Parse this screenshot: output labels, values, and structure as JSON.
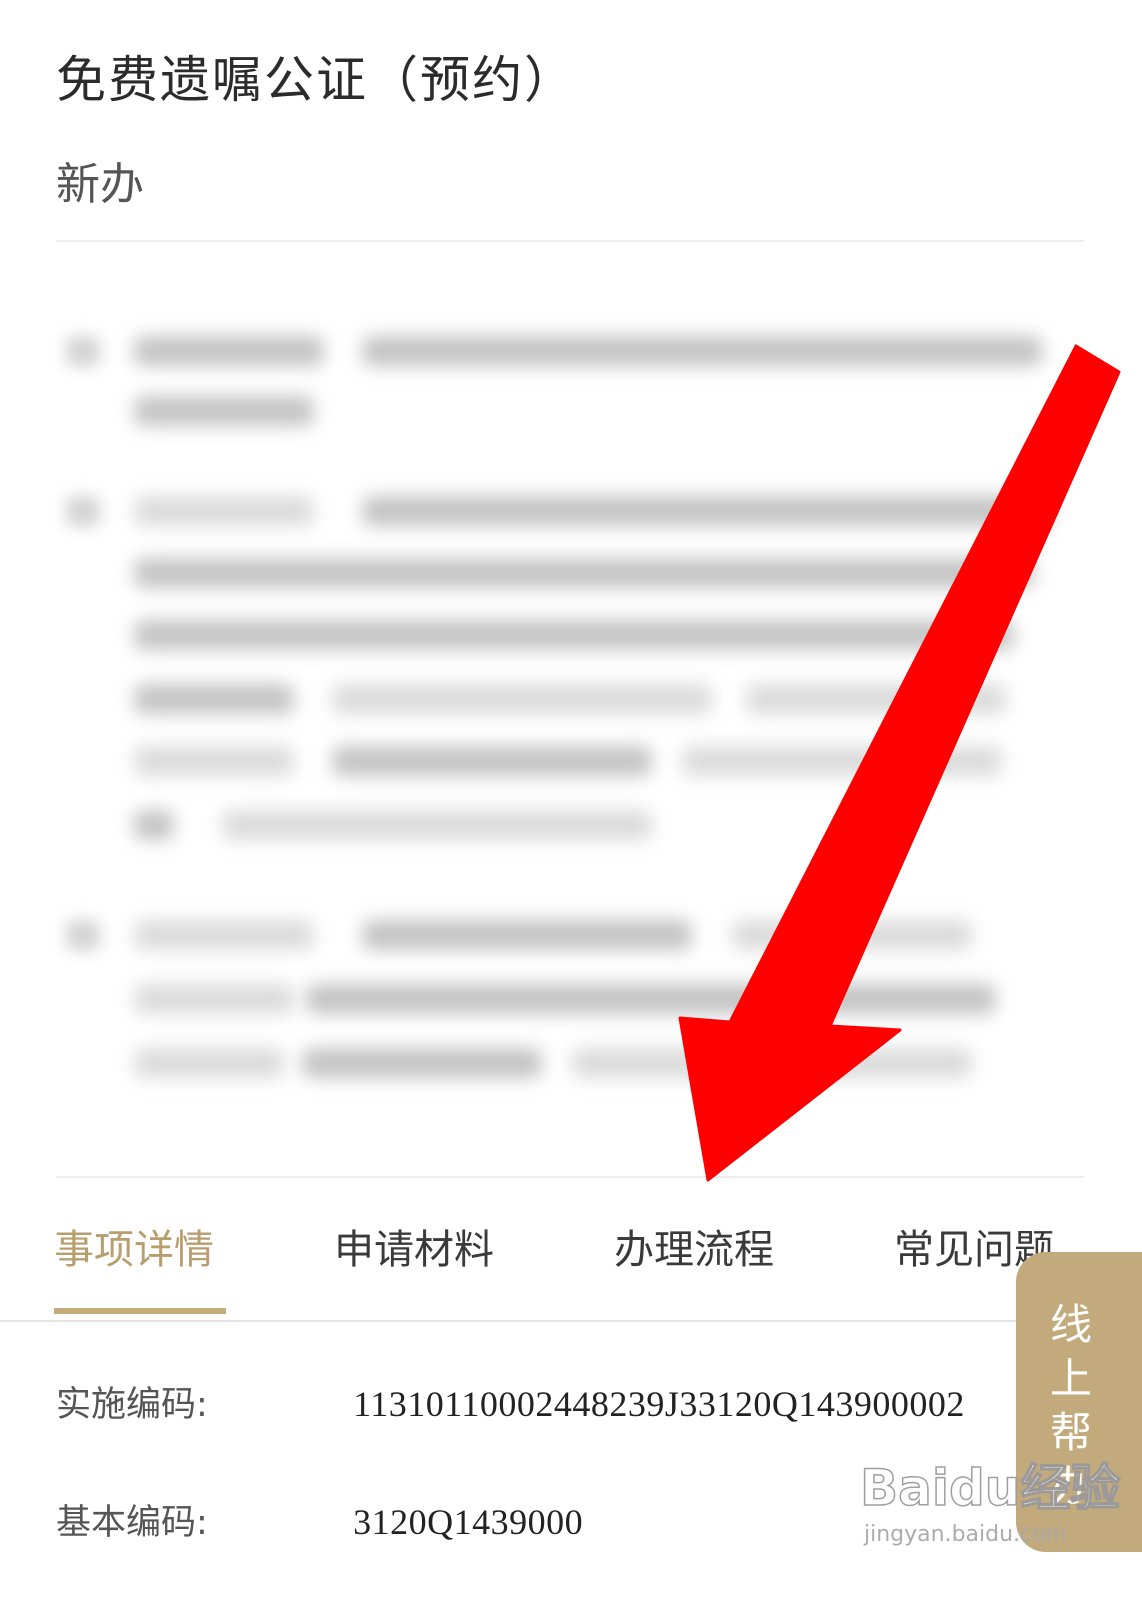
{
  "header": {
    "title": "免费遗嘱公证（预约）",
    "subtitle": "新办"
  },
  "tabs": [
    {
      "label": "事项详情",
      "active": true
    },
    {
      "label": "申请材料",
      "active": false
    },
    {
      "label": "办理流程",
      "active": false
    },
    {
      "label": "常见问题",
      "active": false
    }
  ],
  "details": {
    "impl_code_label": "实施编码:",
    "impl_code_value": "11310110002448239J33120Q143900002",
    "base_code_label": "基本编码:",
    "base_code_value": "3120Q1439000"
  },
  "help_button": {
    "label": "线上帮办"
  },
  "watermark": {
    "logo": "Baidu经验",
    "url": "jingyan.baidu.com"
  },
  "colors": {
    "accent_gold": "#c3aa7c",
    "active_tab": "#b89d6d",
    "annotation_arrow": "#ff0000"
  },
  "icons": {
    "annotation": "red-arrow-annotation"
  }
}
